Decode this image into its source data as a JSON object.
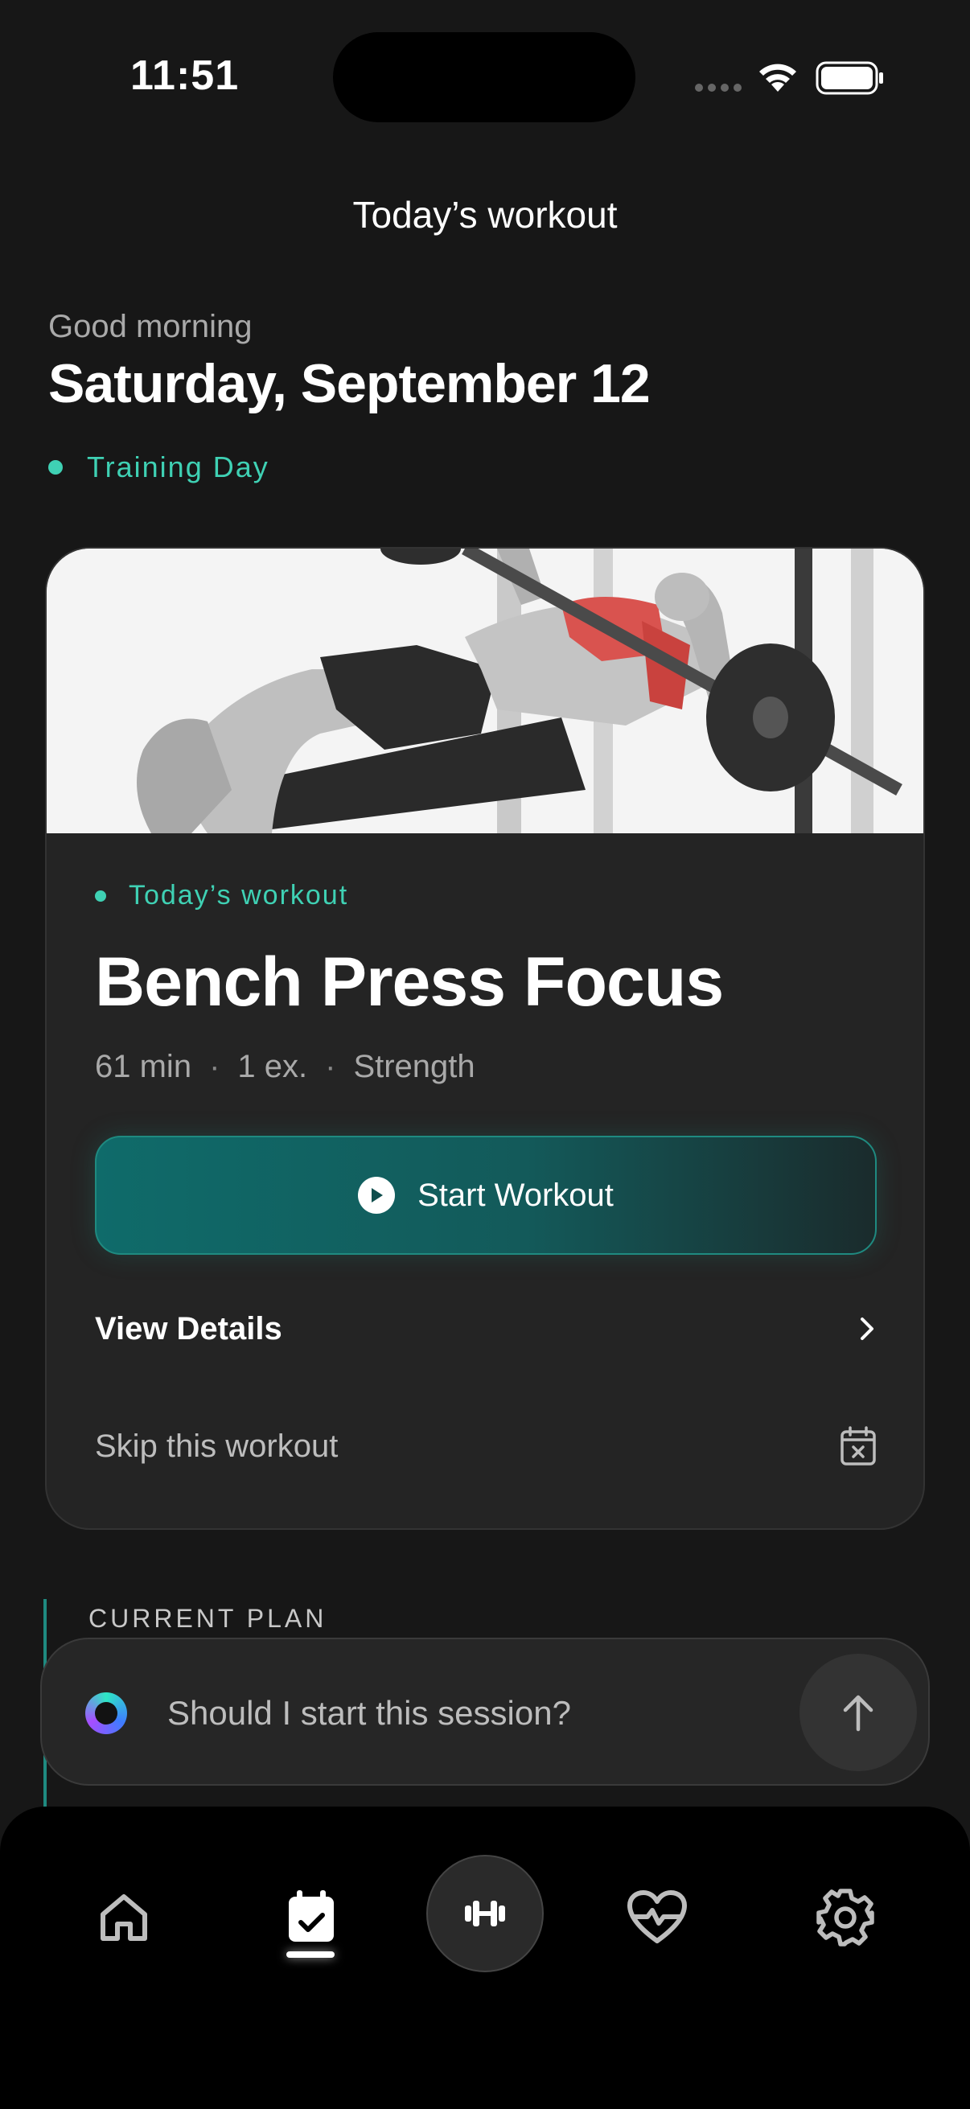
{
  "status_bar": {
    "time": "11:51"
  },
  "header": {
    "title": "Today’s workout"
  },
  "greeting": "Good morning",
  "date": "Saturday, September 12",
  "day_type": "Training Day",
  "workout": {
    "tag": "Today’s workout",
    "title": "Bench Press Focus",
    "duration": "61 min",
    "exercises": "1 ex.",
    "category": "Strength",
    "separator": "·",
    "start_label": "Start Workout",
    "details_label": "View Details",
    "skip_label": "Skip this workout"
  },
  "plan": {
    "label": "CURRENT PLAN"
  },
  "ask": {
    "placeholder": "Should I start this session?"
  },
  "colors": {
    "accent": "#3fd1b4",
    "background": "#171717",
    "card": "#242424"
  },
  "icons": {
    "tabs": [
      "home-icon",
      "calendar-check-icon",
      "dumbbell-icon",
      "heart-pulse-icon",
      "gear-icon"
    ]
  }
}
